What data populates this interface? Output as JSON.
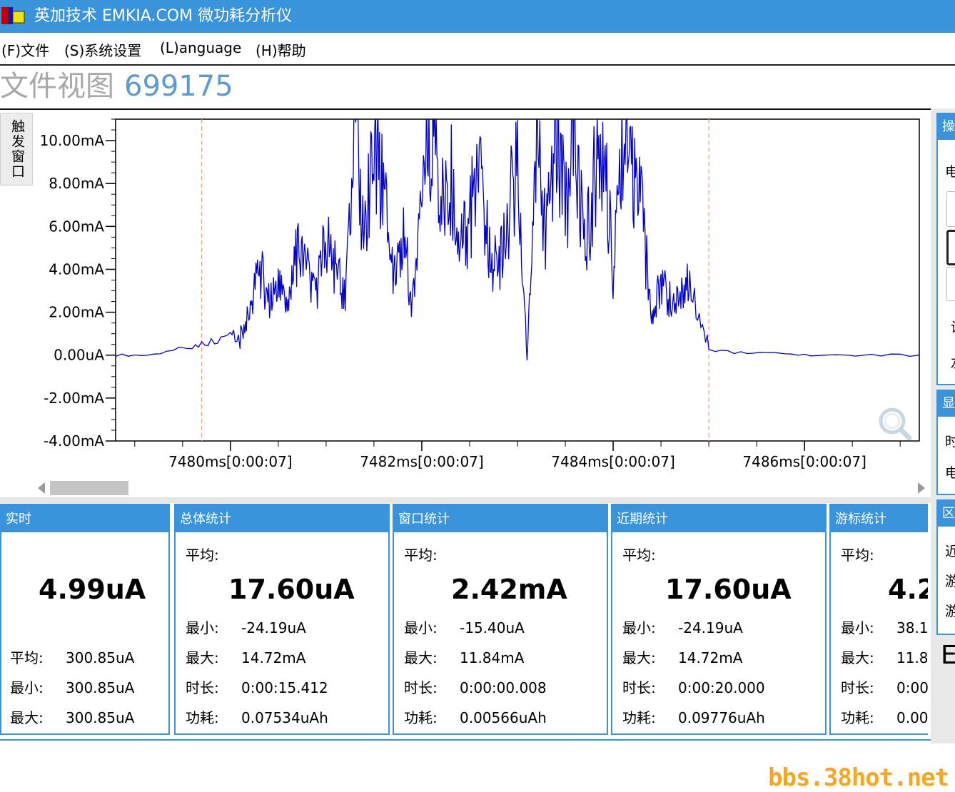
{
  "window": {
    "title": "英加技术 EMKIA.COM 微功耗分析仪",
    "accent": "#3a94dc"
  },
  "menu": [
    {
      "label": "(F)文件"
    },
    {
      "label": "(S)系统设置"
    },
    {
      "label": "(L)anguage"
    },
    {
      "label": "(H)帮助"
    }
  ],
  "view": {
    "label": "文件视图",
    "number": "699175"
  },
  "trigger_tab": "触发窗口",
  "chart_data": {
    "type": "line",
    "title": "",
    "xlabel": "",
    "ylabel": "",
    "ylim": [
      -4.0,
      11.0
    ],
    "xlim": [
      7478.8,
      7487.2
    ],
    "y_ticks": [
      {
        "value": 10,
        "label": "10.00mA"
      },
      {
        "value": 8,
        "label": "8.00mA"
      },
      {
        "value": 6,
        "label": "6.00mA"
      },
      {
        "value": 4,
        "label": "4.00mA"
      },
      {
        "value": 2,
        "label": "2.00mA"
      },
      {
        "value": 0,
        "label": "0.00uA"
      },
      {
        "value": -2,
        "label": "-2.00mA"
      },
      {
        "value": -4,
        "label": "-4.00mA"
      }
    ],
    "x_ticks": [
      {
        "value": 7480,
        "label": "7480ms[0:00:07]"
      },
      {
        "value": 7482,
        "label": "7482ms[0:00:07]"
      },
      {
        "value": 7484,
        "label": "7484ms[0:00:07]"
      },
      {
        "value": 7486,
        "label": "7486ms[0:00:07]"
      }
    ],
    "cursors_ms": [
      7479.7,
      7485.0
    ],
    "series": [
      {
        "color": "#0000cc",
        "x": [
          7478.8,
          7479.2,
          7479.6,
          7479.8,
          7480.0,
          7480.1,
          7480.2,
          7480.3,
          7480.4,
          7480.5,
          7480.6,
          7480.7,
          7480.8,
          7480.9,
          7481.0,
          7481.1,
          7481.2,
          7481.3,
          7481.4,
          7481.5,
          7481.6,
          7481.7,
          7481.8,
          7481.9,
          7482.0,
          7482.1,
          7482.2,
          7482.3,
          7482.4,
          7482.5,
          7482.6,
          7482.7,
          7482.8,
          7482.9,
          7483.0,
          7483.1,
          7483.2,
          7483.3,
          7483.4,
          7483.5,
          7483.6,
          7483.7,
          7483.8,
          7483.9,
          7484.0,
          7484.1,
          7484.2,
          7484.3,
          7484.4,
          7484.5,
          7484.6,
          7484.7,
          7484.8,
          7485.0,
          7485.4,
          7485.8,
          7486.2,
          7486.6,
          7487.2
        ],
        "y": [
          0.0,
          0.0,
          0.4,
          0.7,
          1.0,
          0.8,
          2.0,
          4.2,
          2.5,
          3.2,
          2.0,
          5.0,
          3.8,
          3.0,
          5.5,
          4.0,
          2.5,
          9.8,
          5.5,
          9.5,
          7.5,
          4.0,
          6.0,
          2.3,
          8.0,
          11.0,
          7.0,
          8.5,
          5.0,
          6.5,
          8.0,
          5.0,
          3.8,
          6.5,
          9.0,
          0.0,
          9.5,
          5.5,
          11.0,
          6.5,
          11.0,
          5.0,
          8.0,
          9.5,
          4.0,
          11.0,
          8.0,
          6.5,
          1.8,
          3.5,
          2.5,
          3.0,
          3.5,
          0.2,
          0.1,
          0.05,
          0.0,
          0.0,
          0.0
        ]
      }
    ]
  },
  "panels": [
    {
      "title": "实时",
      "value": "4.99uA",
      "rows": [
        {
          "k": "平均:",
          "v": "300.85uA"
        },
        {
          "k": "最小:",
          "v": "300.85uA"
        },
        {
          "k": "最大:",
          "v": "300.85uA"
        }
      ]
    },
    {
      "title": "总体统计",
      "avg_label": "平均:",
      "value": "17.60uA",
      "rows": [
        {
          "k": "最小:",
          "v": "-24.19uA"
        },
        {
          "k": "最大:",
          "v": "14.72mA"
        },
        {
          "k": "时长:",
          "v": "0:00:15.412"
        },
        {
          "k": "功耗:",
          "v": "0.07534uAh"
        }
      ]
    },
    {
      "title": "窗口统计",
      "avg_label": "平均:",
      "value": "2.42mA",
      "rows": [
        {
          "k": "最小:",
          "v": "-15.40uA"
        },
        {
          "k": "最大:",
          "v": "11.84mA"
        },
        {
          "k": "时长:",
          "v": "0:00:00.008"
        },
        {
          "k": "功耗:",
          "v": "0.00566uAh"
        }
      ]
    },
    {
      "title": "近期统计",
      "avg_label": "平均:",
      "value": "17.60uA",
      "rows": [
        {
          "k": "最小:",
          "v": "-24.19uA"
        },
        {
          "k": "最大:",
          "v": "14.72mA"
        },
        {
          "k": "时长:",
          "v": "0:00:20.000"
        },
        {
          "k": "功耗:",
          "v": "0.09776uAh"
        }
      ]
    },
    {
      "title": "游标统计",
      "avg_label": "平均:",
      "value": "4.2",
      "rows": [
        {
          "k": "最小:",
          "v": "38.1"
        },
        {
          "k": "最大:",
          "v": "11.8"
        },
        {
          "k": "时长:",
          "v": "0:00"
        },
        {
          "k": "功耗:",
          "v": "0.00"
        }
      ]
    }
  ],
  "right_panel": {
    "box1_title": "操",
    "box1_texts": [
      "电",
      "设",
      "左"
    ],
    "box2_title": "显",
    "box2_texts": [
      "时",
      "电"
    ],
    "box3_title": "区",
    "box3_texts": [
      "近",
      "游",
      "游"
    ],
    "letter": "E"
  },
  "watermark": "bbs.38hot.net"
}
